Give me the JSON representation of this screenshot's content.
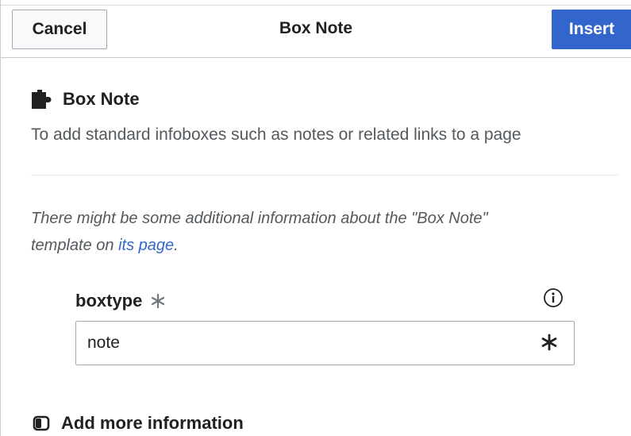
{
  "header": {
    "cancel_label": "Cancel",
    "title": "Box Note",
    "insert_label": "Insert"
  },
  "template": {
    "icon": "puzzle-icon",
    "name": "Box Note",
    "description": "To add standard infoboxes such as notes or related links to a page"
  },
  "more_info": {
    "line1_prefix": "There might be some additional information about the \"Box Note\"",
    "line2_prefix": "template on ",
    "link_text": "its page",
    "line2_suffix": "."
  },
  "parameter": {
    "name": "boxtype",
    "required_icon": "asterisk-icon",
    "info_icon": "info-icon",
    "value": "note"
  },
  "add_more": {
    "icon": "toggle-icon",
    "label": "Add more information"
  },
  "colors": {
    "accent": "#3366cc",
    "border": "#a2a9b1",
    "text": "#202122",
    "muted_text": "#54595d"
  }
}
